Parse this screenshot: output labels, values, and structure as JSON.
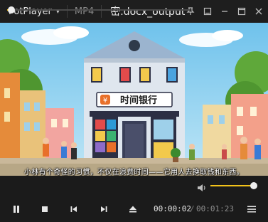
{
  "titlebar": {
    "app_name": "PotPlayer",
    "format": "MP4",
    "filename": "密.docx_output"
  },
  "video": {
    "sign_text": "时间银行",
    "subtitle": "小林有个奇怪的习惯，不仅在浪费时间——它用人去换取钱和东西。"
  },
  "playback": {
    "current_time": "00:00:02",
    "separator": "/",
    "total_time": "00:01:23",
    "progress": 0.024,
    "volume": 0.98
  },
  "colors": {
    "accent": "#f2c21a",
    "background": "#1b1b1b"
  },
  "icons": [
    "pin-icon",
    "mini-icon",
    "minimize-icon",
    "maximize-icon",
    "close-icon",
    "volume-icon",
    "pause-icon",
    "stop-icon",
    "previous-icon",
    "next-icon",
    "eject-icon",
    "menu-icon"
  ]
}
